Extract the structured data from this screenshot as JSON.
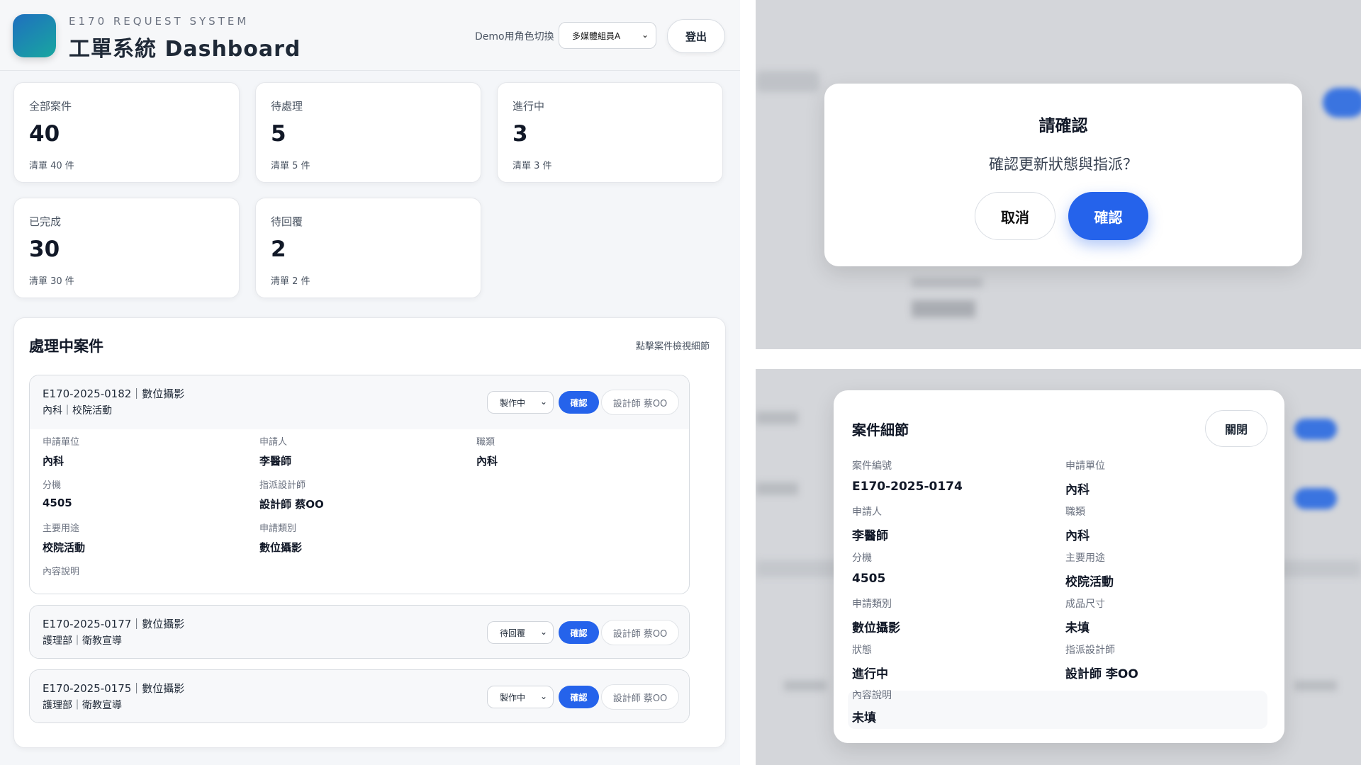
{
  "header": {
    "subtitle": "E170 REQUEST SYSTEM",
    "title": "工單系統 Dashboard",
    "role_label": "Demo用角色切換",
    "role_value": "多媒體組員A",
    "logout_label": "登出"
  },
  "stats": [
    {
      "label": "全部案件",
      "value": "40",
      "sub": "清單 40 件"
    },
    {
      "label": "待處理",
      "value": "5",
      "sub": "清單 5 件"
    },
    {
      "label": "進行中",
      "value": "3",
      "sub": "清單 3 件"
    },
    {
      "label": "已完成",
      "value": "30",
      "sub": "清單 30 件"
    },
    {
      "label": "待回覆",
      "value": "2",
      "sub": "清單 2 件"
    }
  ],
  "panel": {
    "title": "處理中案件",
    "hint": "點擊案件檢視細節"
  },
  "cases": [
    {
      "title": "E170-2025-0182｜數位攝影",
      "sub": "內科｜校院活動",
      "status": "製作中",
      "confirm": "確認",
      "designer": "設計師 蔡OO",
      "details": {
        "unit_k": "申請單位",
        "unit_v": "內科",
        "applicant_k": "申請人",
        "applicant_v": "李醫師",
        "title_k": "職類",
        "title_v": "內科",
        "ext_k": "分機",
        "ext_v": "4505",
        "designer_k": "指派設計師",
        "designer_v": "設計師 蔡OO",
        "purpose_k": "主要用途",
        "purpose_v": "校院活動",
        "category_k": "申請類別",
        "category_v": "數位攝影",
        "desc_k": "內容說明"
      }
    },
    {
      "title": "E170-2025-0177｜數位攝影",
      "sub": "護理部｜衛教宣導",
      "status": "待回覆",
      "confirm": "確認",
      "designer": "設計師 蔡OO"
    },
    {
      "title": "E170-2025-0175｜數位攝影",
      "sub": "護理部｜衛教宣導",
      "status": "製作中",
      "confirm": "確認",
      "designer": "設計師 蔡OO"
    }
  ],
  "confirm_dialog": {
    "title": "請確認",
    "message": "確認更新狀態與指派？",
    "cancel": "取消",
    "ok": "確認"
  },
  "case_modal": {
    "title": "案件細節",
    "close": "關閉",
    "fields": [
      {
        "k": "案件編號",
        "v": "E170-2025-0174"
      },
      {
        "k": "申請單位",
        "v": "內科"
      },
      {
        "k": "申請人",
        "v": "李醫師"
      },
      {
        "k": "職類",
        "v": "內科"
      },
      {
        "k": "分機",
        "v": "4505"
      },
      {
        "k": "主要用途",
        "v": "校院活動"
      },
      {
        "k": "申請類別",
        "v": "數位攝影"
      },
      {
        "k": "成品尺寸",
        "v": "未填"
      },
      {
        "k": "狀態",
        "v": "進行中"
      },
      {
        "k": "指派設計師",
        "v": "設計師 李OO"
      },
      {
        "k": "內容說明",
        "v": "未填"
      }
    ]
  },
  "colors": {
    "accent": "#2563eb",
    "logo_start": "#1f6fbf",
    "logo_end": "#18a7a0"
  },
  "icons": [
    "logo-icon",
    "chevron-down-icon"
  ]
}
